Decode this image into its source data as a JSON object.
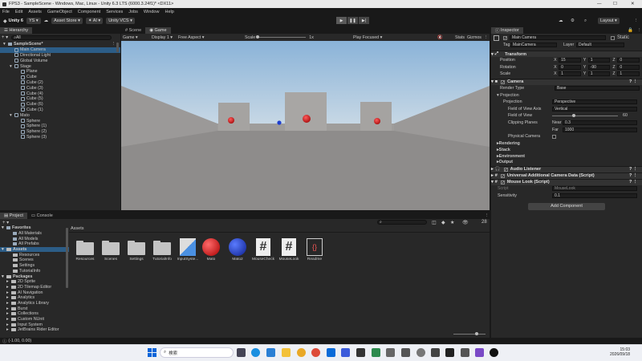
{
  "window_title": "FPS3 - SampleScene - Windows, Mac, Linux - Unity 6.3 LTS (6000.3.24f1)* <DX11>",
  "window_controls": [
    "—",
    "☐",
    "✕"
  ],
  "menu": [
    "File",
    "Edit",
    "Assets",
    "GameObject",
    "Component",
    "Services",
    "Jobs",
    "Window",
    "Help"
  ],
  "toolbar": {
    "account": "Unity 6",
    "ys": "YS",
    "store": "Asset Store",
    "ai": "AI",
    "vcs": "Unity VCS",
    "layout": "Layout"
  },
  "hierarchy": {
    "tab": "Hierarchy",
    "search": "All",
    "items": [
      {
        "label": "SampleScene*",
        "d": 0,
        "kind": "scene"
      },
      {
        "label": "Main Camera",
        "d": 1,
        "kind": "obj",
        "sel": true
      },
      {
        "label": "Directional Light",
        "d": 1,
        "kind": "obj"
      },
      {
        "label": "Global Volume",
        "d": 1,
        "kind": "obj"
      },
      {
        "label": "Stage",
        "d": 1,
        "kind": "obj",
        "fold": true
      },
      {
        "label": "Plane",
        "d": 2,
        "kind": "obj"
      },
      {
        "label": "Cube",
        "d": 2,
        "kind": "obj"
      },
      {
        "label": "Cube (2)",
        "d": 2,
        "kind": "obj"
      },
      {
        "label": "Cube (3)",
        "d": 2,
        "kind": "obj"
      },
      {
        "label": "Cube (4)",
        "d": 2,
        "kind": "obj"
      },
      {
        "label": "Cube (5)",
        "d": 2,
        "kind": "obj"
      },
      {
        "label": "Cube (6)",
        "d": 2,
        "kind": "obj"
      },
      {
        "label": "Cube (1)",
        "d": 2,
        "kind": "obj"
      },
      {
        "label": "Mato",
        "d": 1,
        "kind": "obj",
        "fold": true
      },
      {
        "label": "Sphere",
        "d": 2,
        "kind": "obj"
      },
      {
        "label": "Sphere (1)",
        "d": 2,
        "kind": "obj"
      },
      {
        "label": "Sphere (2)",
        "d": 2,
        "kind": "obj"
      },
      {
        "label": "Sphere (3)",
        "d": 2,
        "kind": "obj"
      }
    ]
  },
  "view_tabs": {
    "scene": "Scene",
    "game": "Game"
  },
  "game_bar": {
    "mode": "Game",
    "display": "Display 1",
    "aspect": "Free Aspect",
    "scale_label": "Scale",
    "scale_value": "1x",
    "play_focused": "Play Focused",
    "stats": "Stats",
    "gizmos": "Gizmos"
  },
  "inspector": {
    "tab": "Inspector",
    "name": "Main Camera",
    "static": "Static",
    "tag_label": "Tag",
    "tag": "MainCamera",
    "layer_label": "Layer",
    "layer": "Default",
    "transform": {
      "title": "Transform",
      "position_label": "Position",
      "rotation_label": "Rotation",
      "scale_label": "Scale",
      "position": [
        "15",
        "1",
        "0"
      ],
      "rotation": [
        "0",
        "-90",
        "0"
      ],
      "scale": [
        "1",
        "1",
        "1"
      ]
    },
    "camera": {
      "title": "Camera",
      "render_type_label": "Render Type",
      "render_type": "Base",
      "projection_section": "Projection",
      "projection_label": "Projection",
      "projection": "Perspective",
      "fov_axis_label": "Field of View Axis",
      "fov_axis": "Vertical",
      "fov_label": "Field of View",
      "fov": "60",
      "fov_fraction": 0.33,
      "clip_label": "Clipping Planes",
      "near_label": "Near",
      "near": "0.3",
      "far_label": "Far",
      "far": "1000",
      "physical_label": "Physical Camera"
    },
    "sections": [
      "Rendering",
      "Stack",
      "Environment",
      "Output"
    ],
    "components": [
      "Audio Listener",
      "Universal Additional Camera Data (Script)",
      "Mouse Look (Script)"
    ],
    "mouse_look": {
      "script_label": "Script",
      "script": "MouseLook",
      "sens_label": "Sensitivity",
      "sens": "0.1"
    },
    "add_component": "Add Component"
  },
  "project": {
    "tab": "Project",
    "console": "Console",
    "count": "28",
    "favorites": "Favorites",
    "fav_items": [
      "All Materials",
      "All Models",
      "All Prefabs"
    ],
    "assets_root": "Assets",
    "asset_folders": [
      "Resources",
      "Scenes",
      "Settings",
      "TutorialInfo"
    ],
    "packages": "Packages",
    "package_items": [
      "2D Sprite",
      "2D Tilemap Editor",
      "AI Navigation",
      "Analytics",
      "Analytics Library",
      "Burst",
      "Collections",
      "Custom NUnit",
      "Input System",
      "JetBrains Rider Editor"
    ],
    "breadcrumb": "Assets",
    "assets": [
      "Resources",
      "Scenes",
      "Settings",
      "TutorialInfo",
      "InputSyste...",
      "Mato",
      "Mato2",
      "MouseCheck",
      "MouseLook",
      "Readme"
    ]
  },
  "status": "(-1.00, 0.00)",
  "taskbar": {
    "search": "検索",
    "time": "15:03",
    "date": "2026/09/18"
  }
}
